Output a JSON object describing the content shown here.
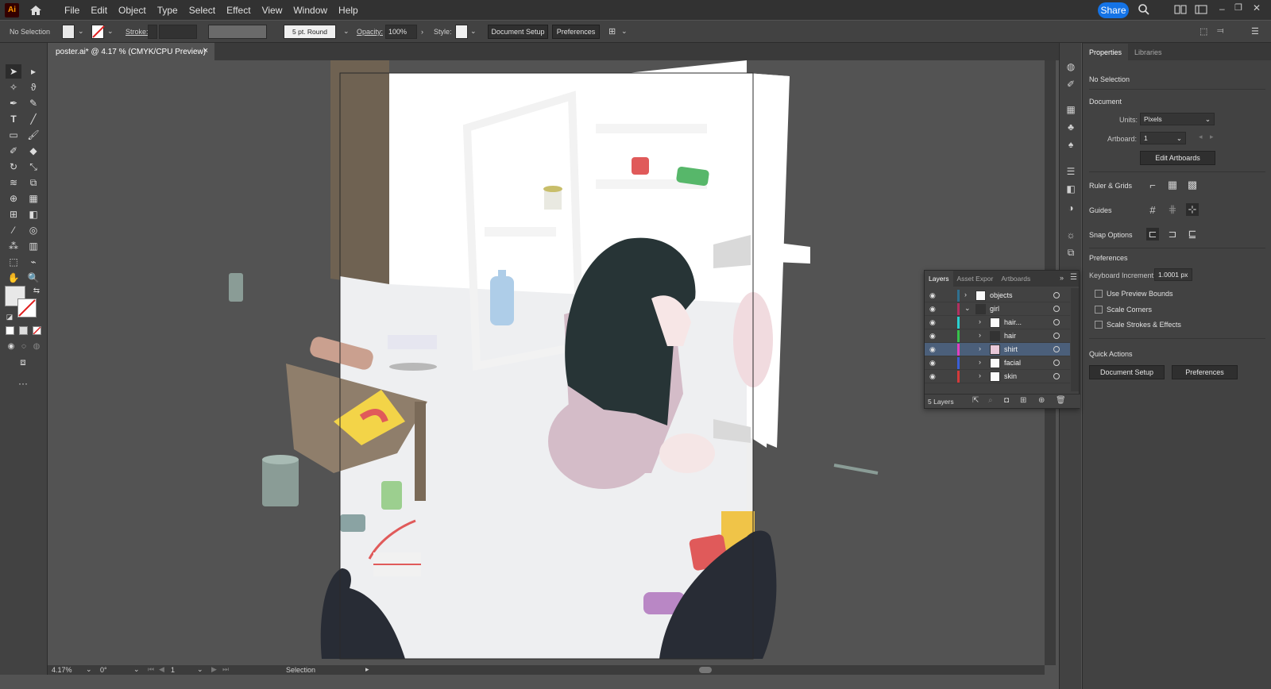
{
  "menubar": {
    "logo": "Ai",
    "items": [
      "File",
      "Edit",
      "Object",
      "Type",
      "Select",
      "Effect",
      "View",
      "Window",
      "Help"
    ],
    "share_label": "Share"
  },
  "controlbar": {
    "selection": "No Selection",
    "stroke_label": "Stroke:",
    "brush": "5 pt. Round",
    "opacity_label": "Opacity:",
    "opacity_value": "100%",
    "style_label": "Style:",
    "doc_setup": "Document Setup",
    "preferences": "Preferences"
  },
  "document": {
    "tab_title": "poster.ai* @ 4.17 % (CMYK/CPU Preview)",
    "close": "×"
  },
  "status": {
    "zoom": "4.17%",
    "rotation": "0°",
    "artboard": "1",
    "tool": "Selection"
  },
  "properties": {
    "tabs": [
      "Properties",
      "Libraries"
    ],
    "selection": "No Selection",
    "document_heading": "Document",
    "units_label": "Units:",
    "units_value": "Pixels",
    "artboard_label": "Artboard:",
    "artboard_value": "1",
    "edit_artboards": "Edit Artboards",
    "ruler_grids": "Ruler & Grids",
    "guides": "Guides",
    "snap_options": "Snap Options",
    "preferences_heading": "Preferences",
    "keyboard_increment_label": "Keyboard Increment:",
    "keyboard_increment_value": "1.0001 px",
    "use_preview_bounds": "Use Preview Bounds",
    "scale_corners": "Scale Corners",
    "scale_strokes": "Scale Strokes & Effects",
    "quick_actions": "Quick Actions",
    "document_setup_btn": "Document Setup",
    "preferences_btn": "Preferences"
  },
  "layers_panel": {
    "tabs": [
      "Layers",
      "Asset Expor",
      "Artboards"
    ],
    "count": "5 Layers",
    "rows": [
      {
        "name": "objects",
        "color": "#2f6f8f"
      },
      {
        "name": "girl",
        "color": "#b03060"
      },
      {
        "name": "hair...",
        "color": "#2ad0d0"
      },
      {
        "name": "hair",
        "color": "#37c24a"
      },
      {
        "name": "shirt",
        "color": "#e040c0"
      },
      {
        "name": "facial",
        "color": "#3a5fd6"
      },
      {
        "name": "skin",
        "color": "#d43a3a"
      }
    ]
  }
}
